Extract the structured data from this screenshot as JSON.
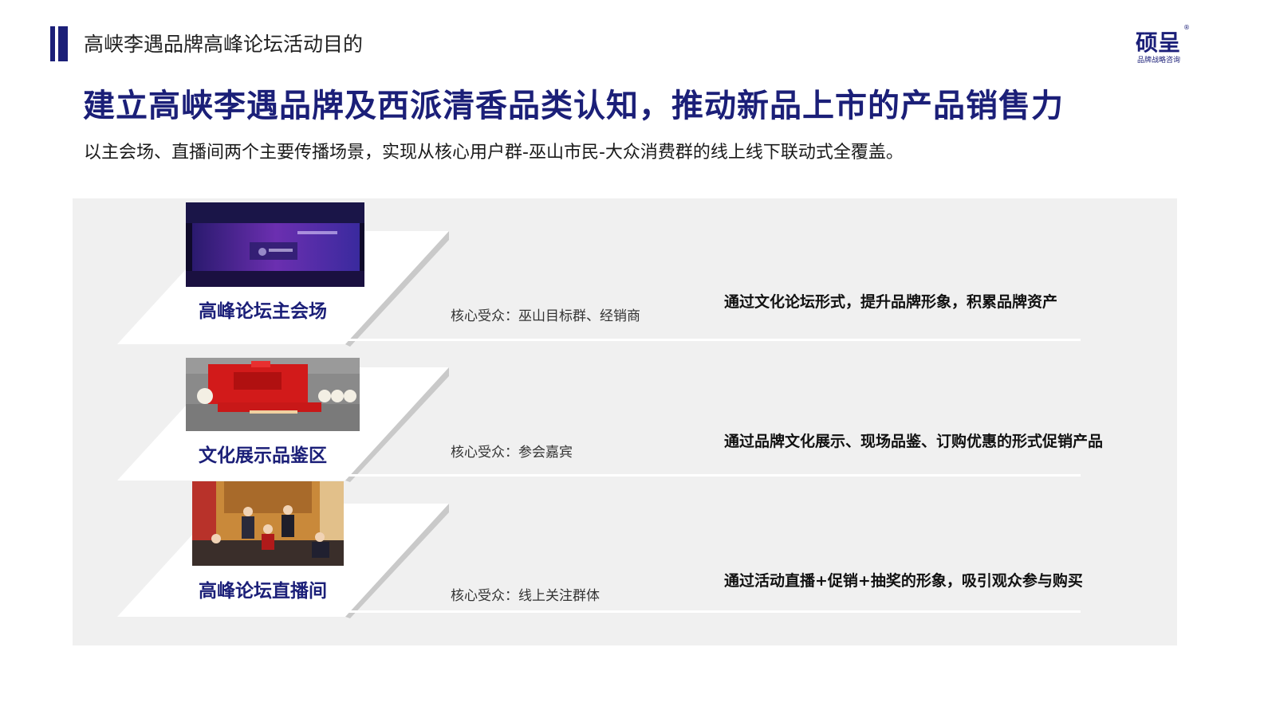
{
  "header": {
    "section_title": "高峡李遇品牌高峰论坛活动目的",
    "logo_text": "硕呈",
    "logo_subtext": "品牌战略咨询",
    "logo_reg": "®"
  },
  "headline": "建立高峡李遇品牌及西派清香品类认知，推动新品上市的产品销售力",
  "subline": "以主会场、直播间两个主要传播场景，实现从核心用户群-巫山市民-大众消费群的线上线下联动式全覆盖。",
  "rows": [
    {
      "title": "高峰论坛主会场",
      "audience": "核心受众：巫山目标群、经销商",
      "description": "通过文化论坛形式，提升品牌形象，积累品牌资产"
    },
    {
      "title": "文化展示品鉴区",
      "audience": "核心受众：参会嘉宾",
      "description": "通过品牌文化展示、现场品鉴、订购优惠的形式促销产品"
    },
    {
      "title": "高峰论坛直播间",
      "audience": "核心受众：线上关注群体",
      "description": "通过活动直播+促销+抽奖的形象，吸引观众参与购买"
    }
  ],
  "colors": {
    "brand": "#1b1f78",
    "panel": "#f0f0f0"
  }
}
